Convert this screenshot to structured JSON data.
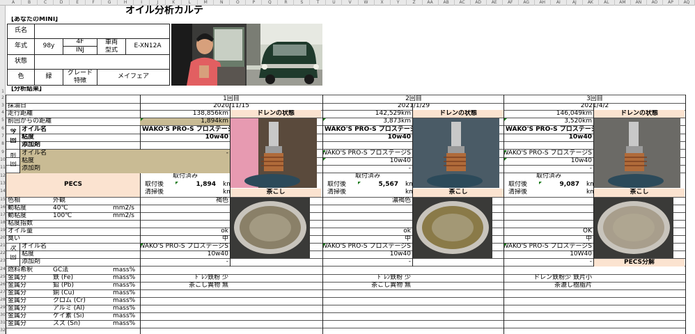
{
  "column_headers": [
    "A",
    "B",
    "C",
    "D",
    "E",
    "F",
    "G",
    "H",
    "I",
    "J",
    "K",
    "L",
    "M",
    "N",
    "O",
    "P",
    "Q",
    "R",
    "S",
    "T",
    "U",
    "V",
    "W",
    "X",
    "Y",
    "Z",
    "AA",
    "AB",
    "AC",
    "AD",
    "AE",
    "AF",
    "AG",
    "AH",
    "AI",
    "AJ",
    "AK",
    "AL",
    "AM",
    "AN",
    "AO",
    "AP",
    "AQ"
  ],
  "row_headers": [
    "1",
    "2",
    "3",
    "4",
    "5",
    "6",
    "7",
    "8",
    "9",
    "10",
    "11",
    "12",
    "13",
    "14",
    "15",
    "16",
    "17",
    "18",
    "19",
    "20",
    "21",
    "22",
    "23",
    "24",
    "25",
    "26",
    "27",
    "28",
    "29",
    "30",
    "31",
    "32",
    "33",
    "34",
    "35",
    "36",
    "37",
    "38",
    "39",
    "40",
    "41",
    "42",
    "43",
    "44",
    "45",
    "46",
    "47",
    "48",
    "49",
    "50",
    "51",
    "52",
    "53",
    "54",
    "55",
    "56",
    "57"
  ],
  "title": "オイル分析カルテ",
  "car_section": {
    "heading": "【あなたのMINI】",
    "name_label": "氏名",
    "year_label": "年式",
    "year_value": "98y",
    "engine_top": "4F",
    "engine_bottom": "INJ",
    "model_label_1": "車両",
    "model_label_2": "型式",
    "model_value": "E-XN12A",
    "state_label": "状態",
    "color_label": "色",
    "color_value": "緑",
    "grade_label_1": "グレード",
    "grade_label_2": "特徴",
    "grade_value": "メイフェア"
  },
  "results_heading": "【分析結果】",
  "row_labels": {
    "date": "採油日",
    "odometer": "走行距離",
    "since_last": "前回からの距離",
    "section_this_1": "今",
    "section_this_2": "回",
    "oil_name": "オイル名",
    "viscosity": "粘度",
    "additive": "添加剤",
    "section_prev_1": "前",
    "section_prev_2": "回",
    "pecs": "PECS",
    "color": "色相",
    "appearance": "外観",
    "visc40": "動粘度",
    "visc40_temp": "40℃",
    "visc_unit": "mm2/s",
    "visc100": "動粘度",
    "visc100_temp": "100℃",
    "visc_index": "粘度指数",
    "oil_amount": "オイル量",
    "smell": "臭い",
    "section_next_1": "次",
    "section_next_2": "回",
    "fuel_dilution": "燃料希釈",
    "gc": "GC法",
    "mass_unit": "mass%",
    "metal": "金属分",
    "fe": "鉄 (Fe)",
    "pb": "鉛 (Pb)",
    "cu": "銅 (Cu)",
    "cr": "クロム (Cr)",
    "al": "アルミ (Al)",
    "si": "ケイ素 (Si)",
    "sn": "スズ (Sn)"
  },
  "labels": {
    "drain_state": "ドレンの状態",
    "strainer": "茶こし",
    "pecs_analysis": "PECS分解",
    "installed": "取付済み",
    "after_install": "取付後",
    "after_clean": "清掃後",
    "km": "km"
  },
  "analyses": [
    {
      "header": "1回目",
      "date": "2020/11/15",
      "odometer": "138,856km",
      "since_last": "1,894km",
      "oil_name": "WAKO'S PRO-S プロステージS",
      "viscosity": "10w40",
      "prev_oil_name": "-",
      "prev_viscosity": "",
      "prev_additive": "",
      "pecs_after_install": "1,894",
      "color": "褐色",
      "oil_amount": "ok",
      "smell": "中",
      "next_oil_name": "WAKO'S PRO-S プロステージS",
      "next_viscosity": "10w40",
      "next_additive": "-",
      "note_1": "ﾄﾞﾚﾝ鉄粉 少",
      "note_2": "茶こし異物 無"
    },
    {
      "header": "2回目",
      "date": "2021/1/29",
      "odometer": "142,529km",
      "since_last": "3,873km",
      "oil_name": "WAKO'S PRO-S プロステージS",
      "viscosity": "10w40",
      "prev_oil_name": "WAKO'S PRO-S プロステージS",
      "prev_viscosity": "10w40",
      "prev_additive": "-",
      "pecs_after_install": "5,567",
      "color": "濃褐色",
      "oil_amount": "ok",
      "smell": "中",
      "next_oil_name": "WAKO'S PRO-S プロステージS",
      "next_viscosity": "10w40",
      "next_additive": "-",
      "note_1": "ﾄﾞﾚﾝ鉄粉 少",
      "note_2": "茶こし異物 無"
    },
    {
      "header": "3回目",
      "date": "2021/4/2",
      "odometer": "146,049km",
      "since_last": "3,520km",
      "oil_name": "WAKO'S PRO-S プロステージS",
      "viscosity": "10w40",
      "prev_oil_name": "WAKO'S PRO-S プロステージS",
      "prev_viscosity": "10w40",
      "prev_additive": "-",
      "pecs_after_install": "9,087",
      "color": "",
      "oil_amount": "OK",
      "smell": "中",
      "next_oil_name": "WAKO'S PRO-S プロステージS",
      "next_viscosity": "10W40",
      "next_additive": "-",
      "note_1": "ドレン鉄粉少 鉄片小",
      "note_2": "茶漉し樹脂片"
    }
  ]
}
